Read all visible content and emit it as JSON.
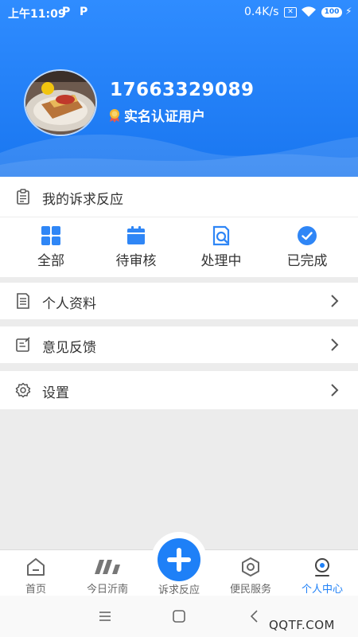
{
  "status_bar": {
    "time": "上午11:09",
    "p1": "P",
    "p2": "P",
    "net_speed": "0.4K/s",
    "battery": "100"
  },
  "profile": {
    "phone": "17663329089",
    "verify_label": "实名认证用户"
  },
  "requests": {
    "title": "我的诉求反应",
    "items": [
      {
        "label": "全部",
        "icon": "grid-icon"
      },
      {
        "label": "待审核",
        "icon": "calendar-icon"
      },
      {
        "label": "处理中",
        "icon": "document-search-icon"
      },
      {
        "label": "已完成",
        "icon": "check-circle-icon"
      }
    ]
  },
  "menu": {
    "profile_label": "个人资料",
    "feedback_label": "意见反馈",
    "settings_label": "设置"
  },
  "tabbar": {
    "home": "首页",
    "today": "今日沂南",
    "report": "诉求反应",
    "service": "便民服务",
    "me": "个人中心"
  },
  "watermark": "QQTF.COM",
  "colors": {
    "accent": "#1e80f7",
    "header_top": "#2f8cff",
    "header_bottom": "#1976f0"
  }
}
